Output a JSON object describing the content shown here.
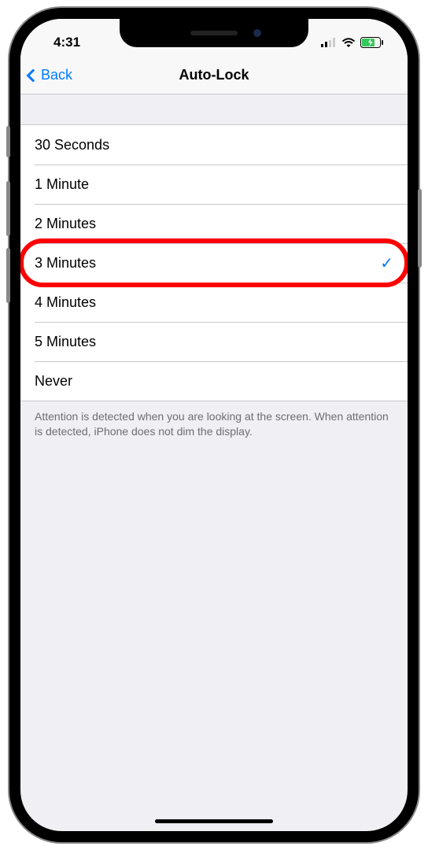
{
  "status": {
    "time": "4:31"
  },
  "nav": {
    "back_label": "Back",
    "title": "Auto-Lock"
  },
  "options": [
    {
      "label": "30 Seconds",
      "selected": false
    },
    {
      "label": "1 Minute",
      "selected": false
    },
    {
      "label": "2 Minutes",
      "selected": false
    },
    {
      "label": "3 Minutes",
      "selected": true,
      "highlighted": true
    },
    {
      "label": "4 Minutes",
      "selected": false
    },
    {
      "label": "5 Minutes",
      "selected": false
    },
    {
      "label": "Never",
      "selected": false
    }
  ],
  "footer": "Attention is detected when you are looking at the screen. When attention is detected, iPhone does not dim the display."
}
